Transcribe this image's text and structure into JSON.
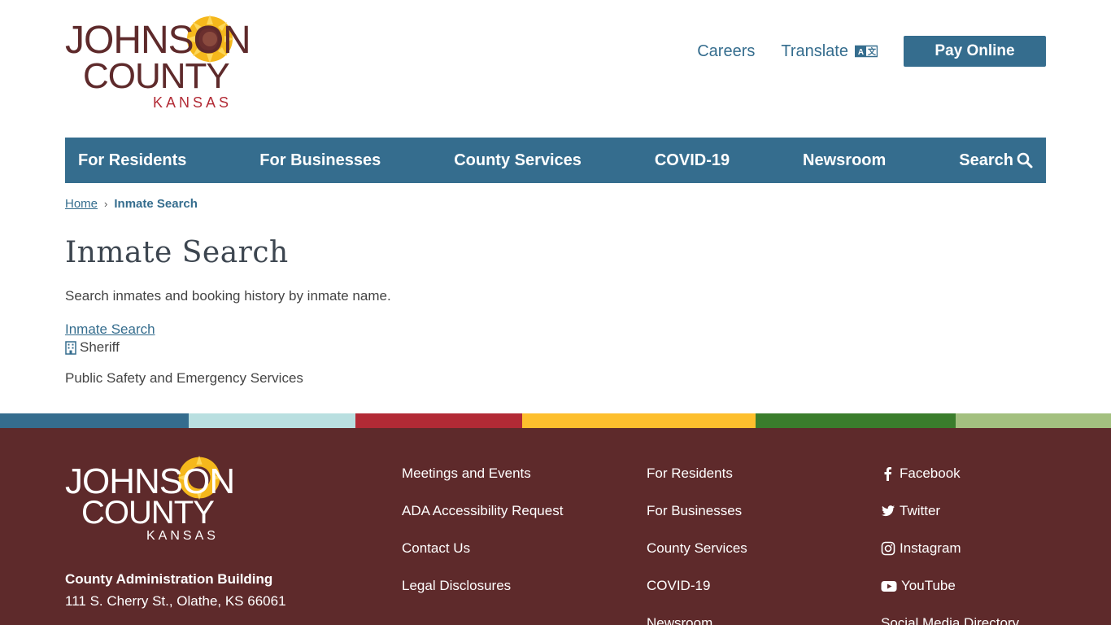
{
  "logo": {
    "line1": "JOHNSON",
    "line2": "COUNTY",
    "line3": "KANSAS"
  },
  "header": {
    "careers_label": "Careers",
    "translate_label": "Translate",
    "pay_label": "Pay Online"
  },
  "nav": {
    "items": [
      {
        "label": "For Residents"
      },
      {
        "label": "For Businesses"
      },
      {
        "label": "County Services"
      },
      {
        "label": "COVID-19"
      },
      {
        "label": "Newsroom"
      },
      {
        "label": "Search"
      }
    ]
  },
  "breadcrumb": {
    "home": "Home",
    "current": "Inmate Search"
  },
  "main": {
    "title": "Inmate Search",
    "description": "Search inmates and booking history by inmate name.",
    "result_link": "Inmate Search",
    "department": "Sheriff",
    "category": "Public Safety and Emergency Services"
  },
  "stripe_colors": [
    "#356d8e",
    "#b9dfe0",
    "#b22a35",
    "#fdbf2d",
    "#3a7d2c",
    "#a3c07f"
  ],
  "colors": {
    "primary": "#356d8e",
    "footer_bg": "#5e2a2b",
    "logo_brown": "#5e2a2b",
    "logo_red": "#b22a35",
    "sunflower": "#f5b81c"
  },
  "footer": {
    "address_title": "County Administration Building",
    "address_line": "111 S. Cherry St., Olathe, KS 66061",
    "col1": [
      "Meetings and Events",
      "ADA Accessibility Request",
      "Contact Us",
      "Legal Disclosures"
    ],
    "col2": [
      "For Residents",
      "For Businesses",
      "County Services",
      "COVID-19",
      "Newsroom"
    ],
    "social": [
      {
        "label": "Facebook",
        "icon": "facebook-icon"
      },
      {
        "label": "Twitter",
        "icon": "twitter-icon"
      },
      {
        "label": "Instagram",
        "icon": "instagram-icon"
      },
      {
        "label": "YouTube",
        "icon": "youtube-icon"
      },
      {
        "label": "Social Media Directory",
        "icon": ""
      }
    ]
  }
}
